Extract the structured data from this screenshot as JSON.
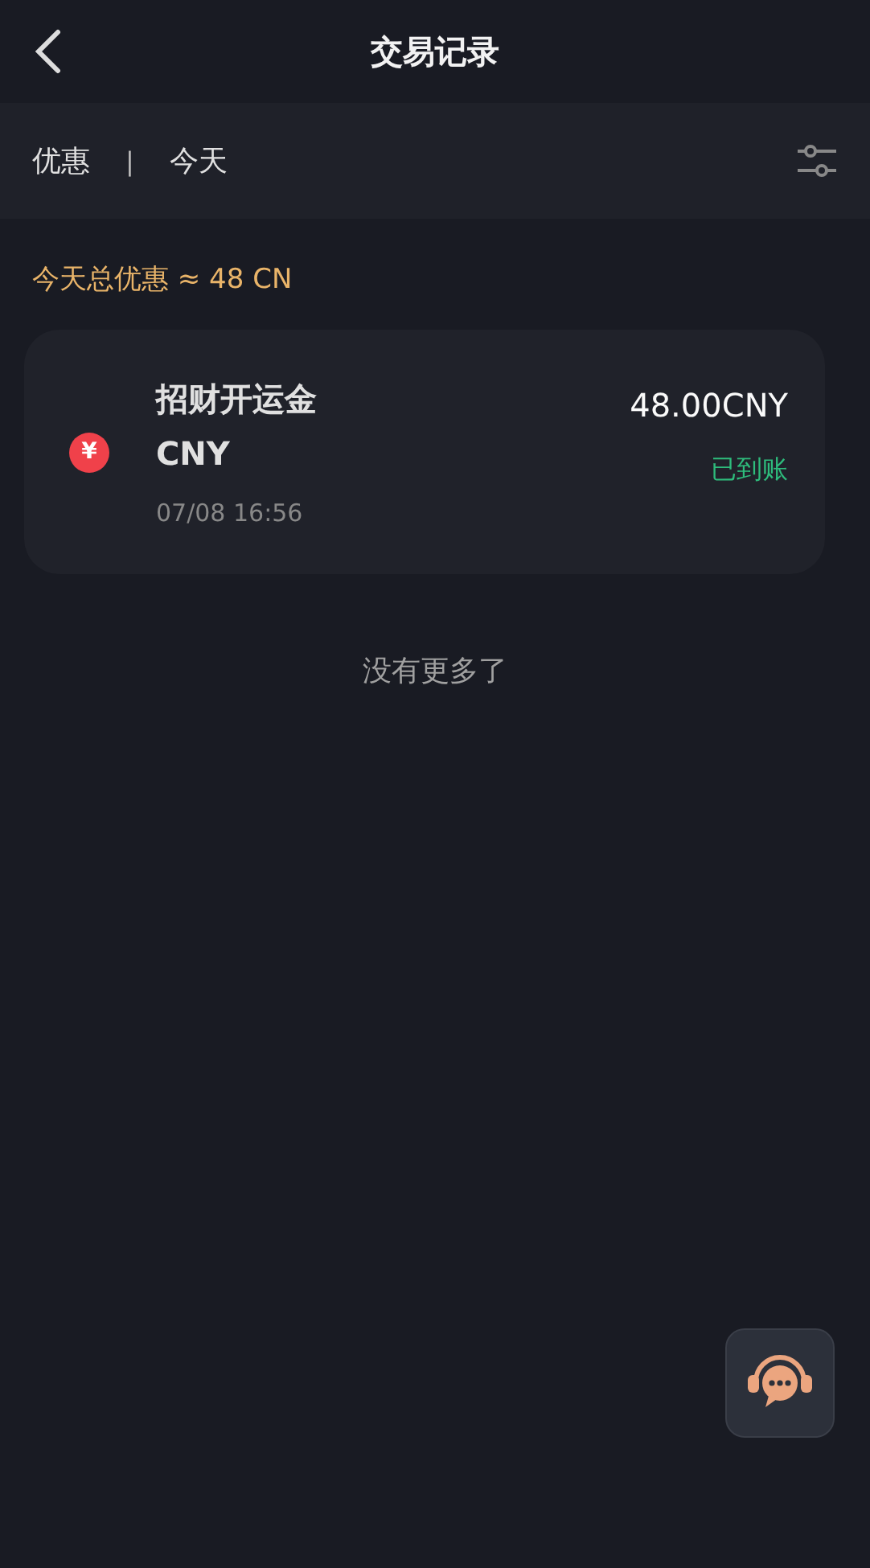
{
  "header": {
    "title": "交易记录"
  },
  "filters": [
    {
      "label": "优惠"
    },
    {
      "label": "今天"
    }
  ],
  "filter_separator": "|",
  "summary": "今天总优惠 ≈ 48 CN",
  "records": [
    {
      "currency_symbol": "¥",
      "title": "招财开运金",
      "currency": "CNY",
      "time": "07/08 16:56",
      "amount": "48.00CNY",
      "status": "已到账"
    }
  ],
  "end_note": "没有更多了"
}
